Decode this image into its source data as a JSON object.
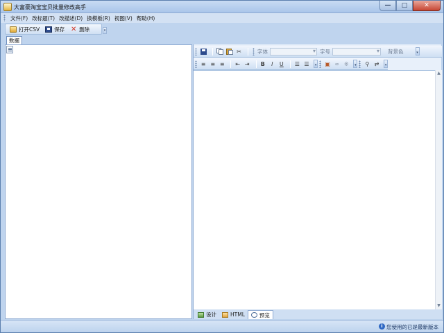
{
  "window": {
    "title": "大富豪淘宝宝贝批量修改高手",
    "controls": {
      "minimize": "—",
      "maximize": "□",
      "close": "✕"
    }
  },
  "menu": [
    {
      "label": "文件(F)"
    },
    {
      "label": "改标题(T)"
    },
    {
      "label": "改描述(D)"
    },
    {
      "label": "换模板(R)"
    },
    {
      "label": "视图(V)"
    },
    {
      "label": "帮助(H)"
    }
  ],
  "toolbar": {
    "open_csv": "打开CSV",
    "save": "保存",
    "delete": "删除",
    "overflow": "▾"
  },
  "tabs": {
    "data": "数据"
  },
  "editor": {
    "toolbar1": {
      "font_label": "字体",
      "size_label": "字号",
      "bgcolor_label": "背景色",
      "font_value": "",
      "size_value": ""
    },
    "mode_tabs": [
      {
        "label": "设计",
        "icon": "design-icon"
      },
      {
        "label": "HTML",
        "icon": "html-icon"
      },
      {
        "label": "预览",
        "icon": "preview-icon",
        "active": true
      }
    ]
  },
  "status": {
    "icon": "info-icon",
    "text": "您使用的已是最新版本"
  },
  "colors": {
    "frame": "#bfd4ee",
    "panel_border": "#8eaad2",
    "close_red": "#c74633"
  }
}
